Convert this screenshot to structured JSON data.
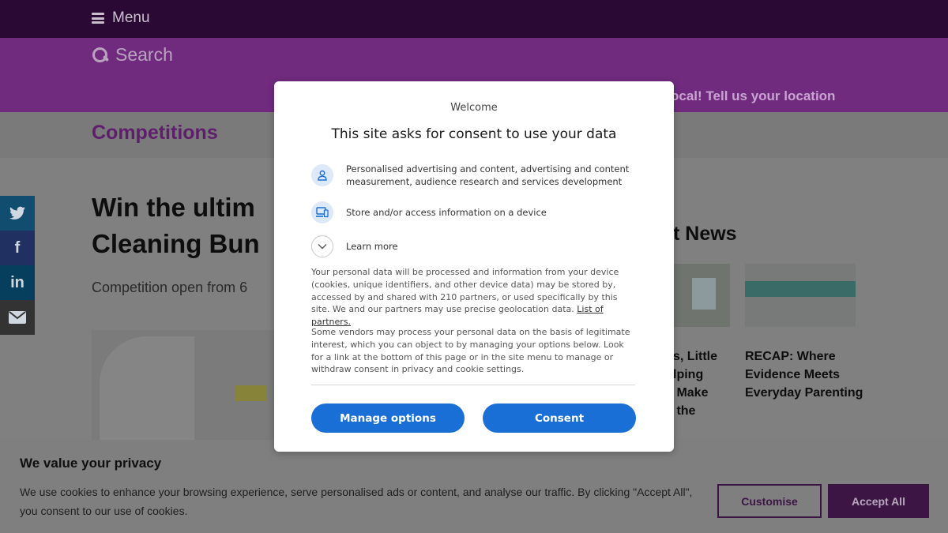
{
  "header": {
    "menu_label": "Menu",
    "search_label": "Search",
    "location_prompt": "ocal! Tell us your location"
  },
  "section": {
    "title": "Competitions"
  },
  "share": {
    "twitter": "t",
    "facebook": "f",
    "linkedin": "in",
    "email": "✉"
  },
  "article": {
    "title_line1": "Win the ultim",
    "title_line2": "Cleaning Bun",
    "subtitle": "Competition open from 6"
  },
  "latest": {
    "title": "t News",
    "items": [
      {
        "title": "s, Little\nlping\n Make\n the"
      },
      {
        "title": "RECAP: Where Evidence Meets Everyday Parenting"
      }
    ]
  },
  "privacy_banner": {
    "title": "We value your privacy",
    "text": "We use cookies to enhance your browsing experience, serve personalised ads or content, and analyse our traffic. By clicking \"Accept All\", you consent to our use of cookies.",
    "customise_label": "Customise",
    "accept_label": "Accept All"
  },
  "consent_modal": {
    "welcome": "Welcome",
    "heading": "This site asks for consent to use your data",
    "purposes": [
      {
        "icon": "person-icon",
        "label": "Personalised advertising and content, advertising and content measurement, audience research and services development"
      },
      {
        "icon": "devices-icon",
        "label": "Store and/or access information on a device"
      }
    ],
    "learn_more": "Learn more",
    "paragraph1": "Your personal data will be processed and information from your device (cookies, unique identifiers, and other device data) may be stored by, accessed by and shared with 210 partners, or used specifically by this site. We and our partners may use precise geolocation data.",
    "partners_link": "List of partners.",
    "paragraph2": "Some vendors may process your personal data on the basis of legitimate interest, which you can object to by managing your options below. Look for a link at the bottom of this page or in the site menu to manage or withdraw consent in privacy and cookie settings.",
    "manage_label": "Manage options",
    "consent_label": "Consent"
  },
  "colors": {
    "topbar": "#2a0a34",
    "searchbar": "#702b7f",
    "brand_dark": "#3c1545",
    "consent_blue": "#1a6fd6"
  }
}
